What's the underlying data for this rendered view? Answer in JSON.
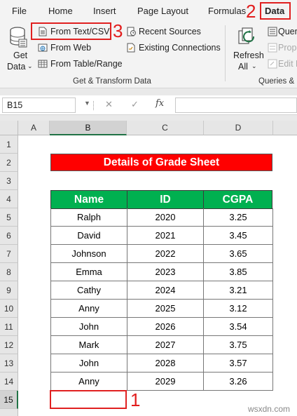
{
  "ribbon": {
    "tabs": [
      "File",
      "Home",
      "Insert",
      "Page Layout",
      "Formulas",
      "Data"
    ],
    "active_tab": "Data",
    "get_data": {
      "label1": "Get",
      "label2": "Data"
    },
    "from_text_csv": "From Text/CSV",
    "from_web": "From Web",
    "from_table_range": "From Table/Range",
    "recent_sources": "Recent Sources",
    "existing_connections": "Existing Connections",
    "refresh_all": {
      "label1": "Refresh",
      "label2": "All"
    },
    "queries_connections": "Quer",
    "properties": "Prope",
    "edit_links": "Edit L",
    "group_get_transform": "Get & Transform Data",
    "group_queries": "Queries &"
  },
  "annotations": {
    "step1": "1",
    "step2": "2",
    "step3": "3"
  },
  "formula_bar": {
    "name_box": "B15",
    "fx": "fx",
    "formula": ""
  },
  "grid": {
    "columns": [
      "A",
      "B",
      "C",
      "D"
    ],
    "selected_column": "B",
    "rows": [
      "1",
      "2",
      "3",
      "4",
      "5",
      "6",
      "7",
      "8",
      "9",
      "10",
      "11",
      "12",
      "13",
      "14",
      "15"
    ],
    "selected_row": "15"
  },
  "sheet": {
    "title": "Details of Grade Sheet",
    "headers": [
      "Name",
      "ID",
      "CGPA"
    ],
    "rows": [
      [
        "Ralph",
        "2020",
        "3.25"
      ],
      [
        "David",
        "2021",
        "3.45"
      ],
      [
        "Johnson",
        "2022",
        "3.65"
      ],
      [
        "Emma",
        "2023",
        "3.85"
      ],
      [
        "Cathy",
        "2024",
        "3.21"
      ],
      [
        "Anny",
        "2025",
        "3.12"
      ],
      [
        "John",
        "2026",
        "3.54"
      ],
      [
        "Mark",
        "2027",
        "3.75"
      ],
      [
        "John",
        "2028",
        "3.57"
      ],
      [
        "Anny",
        "2029",
        "3.26"
      ]
    ]
  },
  "watermark": "wsxdn.com",
  "colors": {
    "title_bg": "#ff0000",
    "header_bg": "#00b050",
    "annotation": "#e21d1d",
    "excel_green": "#217346"
  }
}
